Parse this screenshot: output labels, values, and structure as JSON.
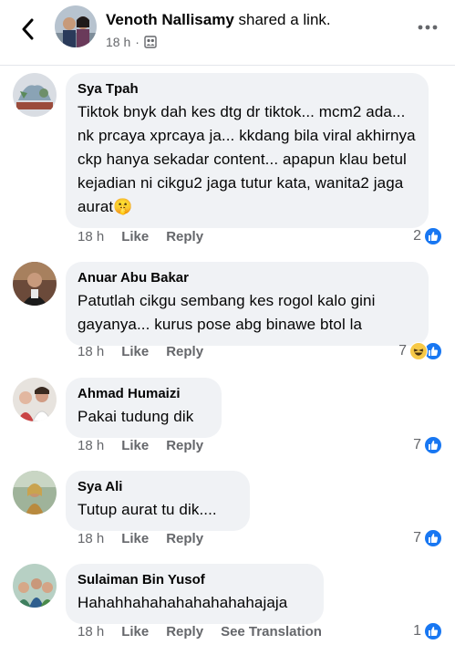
{
  "post": {
    "poster_name": "Venoth Nallisamy",
    "action_text": " shared a link.",
    "time": "18 h",
    "dot": "·"
  },
  "comments": [
    {
      "name": "Sya Tpah",
      "text": "Tiktok bnyk dah kes dtg dr tiktok... mcm2 ada... nk prcaya xprcaya ja... kkdang bila viral akhirnya ckp hanya sekadar content... apapun klau betul kejadian ni cikgu2 jaga tutur kata, wanita2 jaga aurat",
      "emoji": "🤫",
      "time": "18 h",
      "like": "Like",
      "reply": "Reply",
      "reaction_count": "2",
      "reactions": [
        "like"
      ]
    },
    {
      "name": "Anuar Abu Bakar",
      "text": "Patutlah cikgu sembang kes rogol kalo gini gayanya... kurus pose abg binawe btol la",
      "time": "18 h",
      "like": "Like",
      "reply": "Reply",
      "reaction_count": "7",
      "reactions": [
        "haha",
        "like"
      ]
    },
    {
      "name": "Ahmad Humaizi",
      "text": "Pakai tudung dik",
      "time": "18 h",
      "like": "Like",
      "reply": "Reply",
      "reaction_count": "7",
      "reactions": [
        "like"
      ]
    },
    {
      "name": "Sya Ali",
      "text": "Tutup aurat tu dik....",
      "time": "18 h",
      "like": "Like",
      "reply": "Reply",
      "reaction_count": "7",
      "reactions": [
        "like"
      ]
    },
    {
      "name": "Sulaiman Bin Yusof",
      "text": "Hahahhahahahahahahahajaja",
      "time": "18 h",
      "like": "Like",
      "reply": "Reply",
      "see_translation": "See Translation",
      "reaction_count": "1",
      "reactions": [
        "like"
      ]
    }
  ],
  "colors": {
    "bubble": "#f0f2f5",
    "meta_text": "#65676b",
    "like_blue": "#1877f2",
    "haha_yellow": "#f7c947"
  }
}
